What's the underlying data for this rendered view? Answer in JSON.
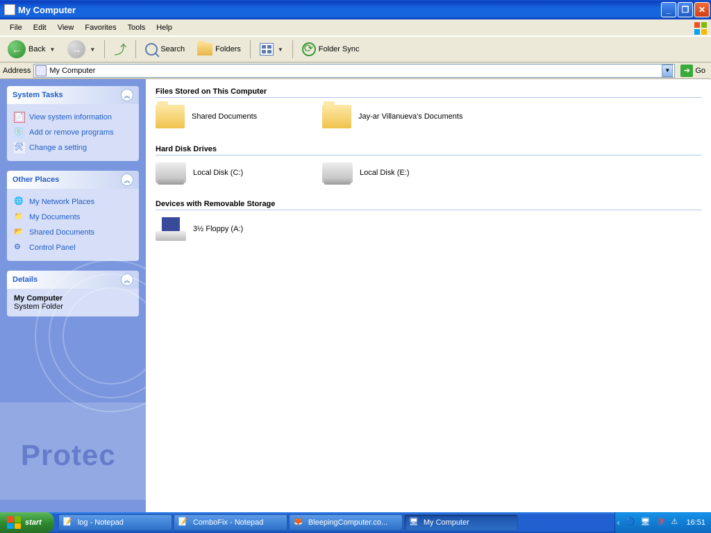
{
  "window": {
    "title": "My Computer"
  },
  "menu": [
    "File",
    "Edit",
    "View",
    "Favorites",
    "Tools",
    "Help"
  ],
  "toolbar": {
    "back": "Back",
    "search": "Search",
    "folders": "Folders",
    "foldersync": "Folder Sync"
  },
  "address": {
    "label": "Address",
    "value": "My Computer",
    "go": "Go"
  },
  "sidebar": {
    "systemtasks": {
      "title": "System Tasks",
      "links": [
        "View system information",
        "Add or remove programs",
        "Change a setting"
      ]
    },
    "otherplaces": {
      "title": "Other Places",
      "links": [
        "My Network Places",
        "My Documents",
        "Shared Documents",
        "Control Panel"
      ]
    },
    "details": {
      "title": "Details",
      "name": "My Computer",
      "type": "System Folder"
    },
    "bgtext": "Protec"
  },
  "content": {
    "groups": [
      {
        "header": "Files Stored on This Computer",
        "items": [
          {
            "icon": "folder",
            "label": "Shared Documents"
          },
          {
            "icon": "folder",
            "label": "Jay-ar Villanueva's Documents"
          }
        ]
      },
      {
        "header": "Hard Disk Drives",
        "items": [
          {
            "icon": "hdd",
            "label": "Local Disk (C:)"
          },
          {
            "icon": "hdd",
            "label": "Local Disk (E:)"
          }
        ]
      },
      {
        "header": "Devices with Removable Storage",
        "items": [
          {
            "icon": "floppy",
            "label": "3½ Floppy (A:)"
          }
        ]
      }
    ]
  },
  "taskbar": {
    "start": "start",
    "buttons": [
      {
        "icon": "notepad",
        "label": "log - Notepad"
      },
      {
        "icon": "notepad",
        "label": "ComboFix - Notepad"
      },
      {
        "icon": "firefox",
        "label": "BleepingComputer.co..."
      },
      {
        "icon": "explorer",
        "label": "My Computer",
        "active": true
      }
    ],
    "clock": "16:51"
  }
}
